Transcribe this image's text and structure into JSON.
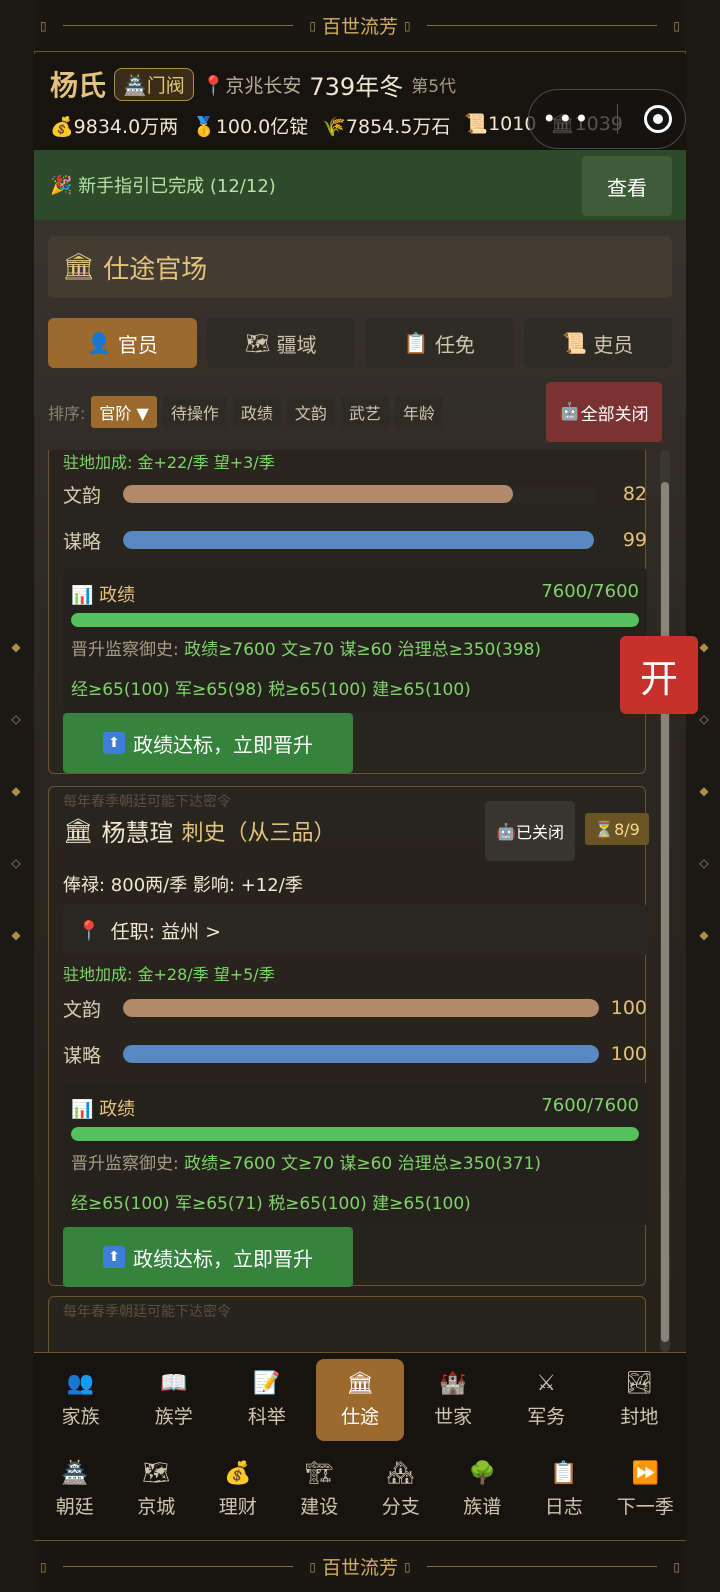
{
  "app": {
    "banner_title": "百世流芳"
  },
  "header": {
    "family_name": "杨氏",
    "rank_badge": "门阀",
    "location": "京兆长安",
    "year": "739年冬",
    "generation": "第5代",
    "resources": [
      {
        "icon": "money-bag-icon",
        "value": "9834.0万两"
      },
      {
        "icon": "medal-icon",
        "value": "100.0亿锭"
      },
      {
        "icon": "grain-icon",
        "value": "7854.5万石"
      },
      {
        "icon": "scroll-icon",
        "value": "1010"
      },
      {
        "icon": "building-icon",
        "value": "1039"
      }
    ]
  },
  "guide": {
    "text": "新手指引已完成 (12/12)",
    "button": "查看"
  },
  "section": {
    "title": "仕途官场"
  },
  "tabs": [
    {
      "label": "官员",
      "icon": "person-icon",
      "active": true
    },
    {
      "label": "疆域",
      "icon": "map-icon",
      "active": false
    },
    {
      "label": "任免",
      "icon": "clipboard-icon",
      "active": false
    },
    {
      "label": "吏员",
      "icon": "scroll-icon",
      "active": false
    }
  ],
  "sort": {
    "label": "排序:",
    "options": [
      "官阶 ▼",
      "待操作",
      "政绩",
      "文韵",
      "武艺",
      "年龄"
    ],
    "close_all": "全部关闭"
  },
  "cards": [
    {
      "bonus": "驻地加成: 金+22/季  望+3/季",
      "stats": [
        {
          "label": "文韵",
          "value": "82",
          "fraction": 0.82,
          "color": "#b08a6a"
        },
        {
          "label": "谋略",
          "value": "99",
          "fraction": 0.99,
          "color": "#5a88c0"
        }
      ],
      "merit": {
        "title": "政绩",
        "value": "7600/7600",
        "fraction": 1.0,
        "req_line1": [
          {
            "k": "晋升监察御史:",
            "v": ""
          },
          {
            "k": "",
            "v": "政绩≥7600"
          },
          {
            "k": "",
            "v": "文≥70"
          },
          {
            "k": "",
            "v": "谋≥60"
          },
          {
            "k": "",
            "v": "治理总≥350(398)"
          }
        ],
        "req_line2": [
          "经≥65(100)",
          "军≥65(98)",
          "税≥65(100)",
          "建≥65(100)"
        ]
      },
      "promote": "政绩达标，立即晋升"
    },
    {
      "faint_note": "每年春季朝廷可能下达密令",
      "name": "杨慧瑄",
      "title": "刺史（从三品）",
      "auto_status": "已关闭",
      "count": "8/9",
      "salary": "俸禄: 800两/季   影响: +12/季",
      "post": "任职: 益州  >",
      "bonus": "驻地加成: 金+28/季  望+5/季",
      "stats": [
        {
          "label": "文韵",
          "value": "100",
          "fraction": 1.0,
          "color": "#b08a6a"
        },
        {
          "label": "谋略",
          "value": "100",
          "fraction": 1.0,
          "color": "#5a88c0"
        }
      ],
      "merit": {
        "title": "政绩",
        "value": "7600/7600",
        "fraction": 1.0,
        "req_line1": [
          {
            "k": "晋升监察御史:",
            "v": ""
          },
          {
            "k": "",
            "v": "政绩≥7600"
          },
          {
            "k": "",
            "v": "文≥70"
          },
          {
            "k": "",
            "v": "谋≥60"
          },
          {
            "k": "",
            "v": "治理总≥350(371)"
          }
        ],
        "req_line2": [
          "经≥65(100)",
          "军≥65(71)",
          "税≥65(100)",
          "建≥65(100)"
        ]
      },
      "promote": "政绩达标，立即晋升"
    },
    {
      "faint_note": "每年春季朝廷可能下达密令"
    }
  ],
  "float_button": "开",
  "nav": {
    "row1": [
      {
        "label": "家族",
        "icon": "family-icon",
        "glyph": "👥"
      },
      {
        "label": "族学",
        "icon": "book-icon",
        "glyph": "📖"
      },
      {
        "label": "科举",
        "icon": "memo-icon",
        "glyph": "📝"
      },
      {
        "label": "仕途",
        "icon": "temple-icon",
        "glyph": "🏛"
      },
      {
        "label": "世家",
        "icon": "castle-icon",
        "glyph": "🏰"
      },
      {
        "label": "军务",
        "icon": "swords-icon",
        "glyph": "⚔"
      },
      {
        "label": "封地",
        "icon": "landscape-icon",
        "glyph": "🏞"
      }
    ],
    "row2": [
      {
        "label": "朝廷",
        "icon": "palace-icon",
        "glyph": "🏯"
      },
      {
        "label": "京城",
        "icon": "city-map-icon",
        "glyph": "🗺"
      },
      {
        "label": "理财",
        "icon": "money-bag-icon",
        "glyph": "💰"
      },
      {
        "label": "建设",
        "icon": "crane-icon",
        "glyph": "🏗"
      },
      {
        "label": "分支",
        "icon": "houses-icon",
        "glyph": "🏘"
      },
      {
        "label": "族谱",
        "icon": "tree-icon",
        "glyph": "🌳"
      },
      {
        "label": "日志",
        "icon": "clipboard-icon",
        "glyph": "📋"
      },
      {
        "label": "下一季",
        "icon": "fast-forward-icon",
        "glyph": "⏩"
      }
    ],
    "active": "仕途"
  }
}
